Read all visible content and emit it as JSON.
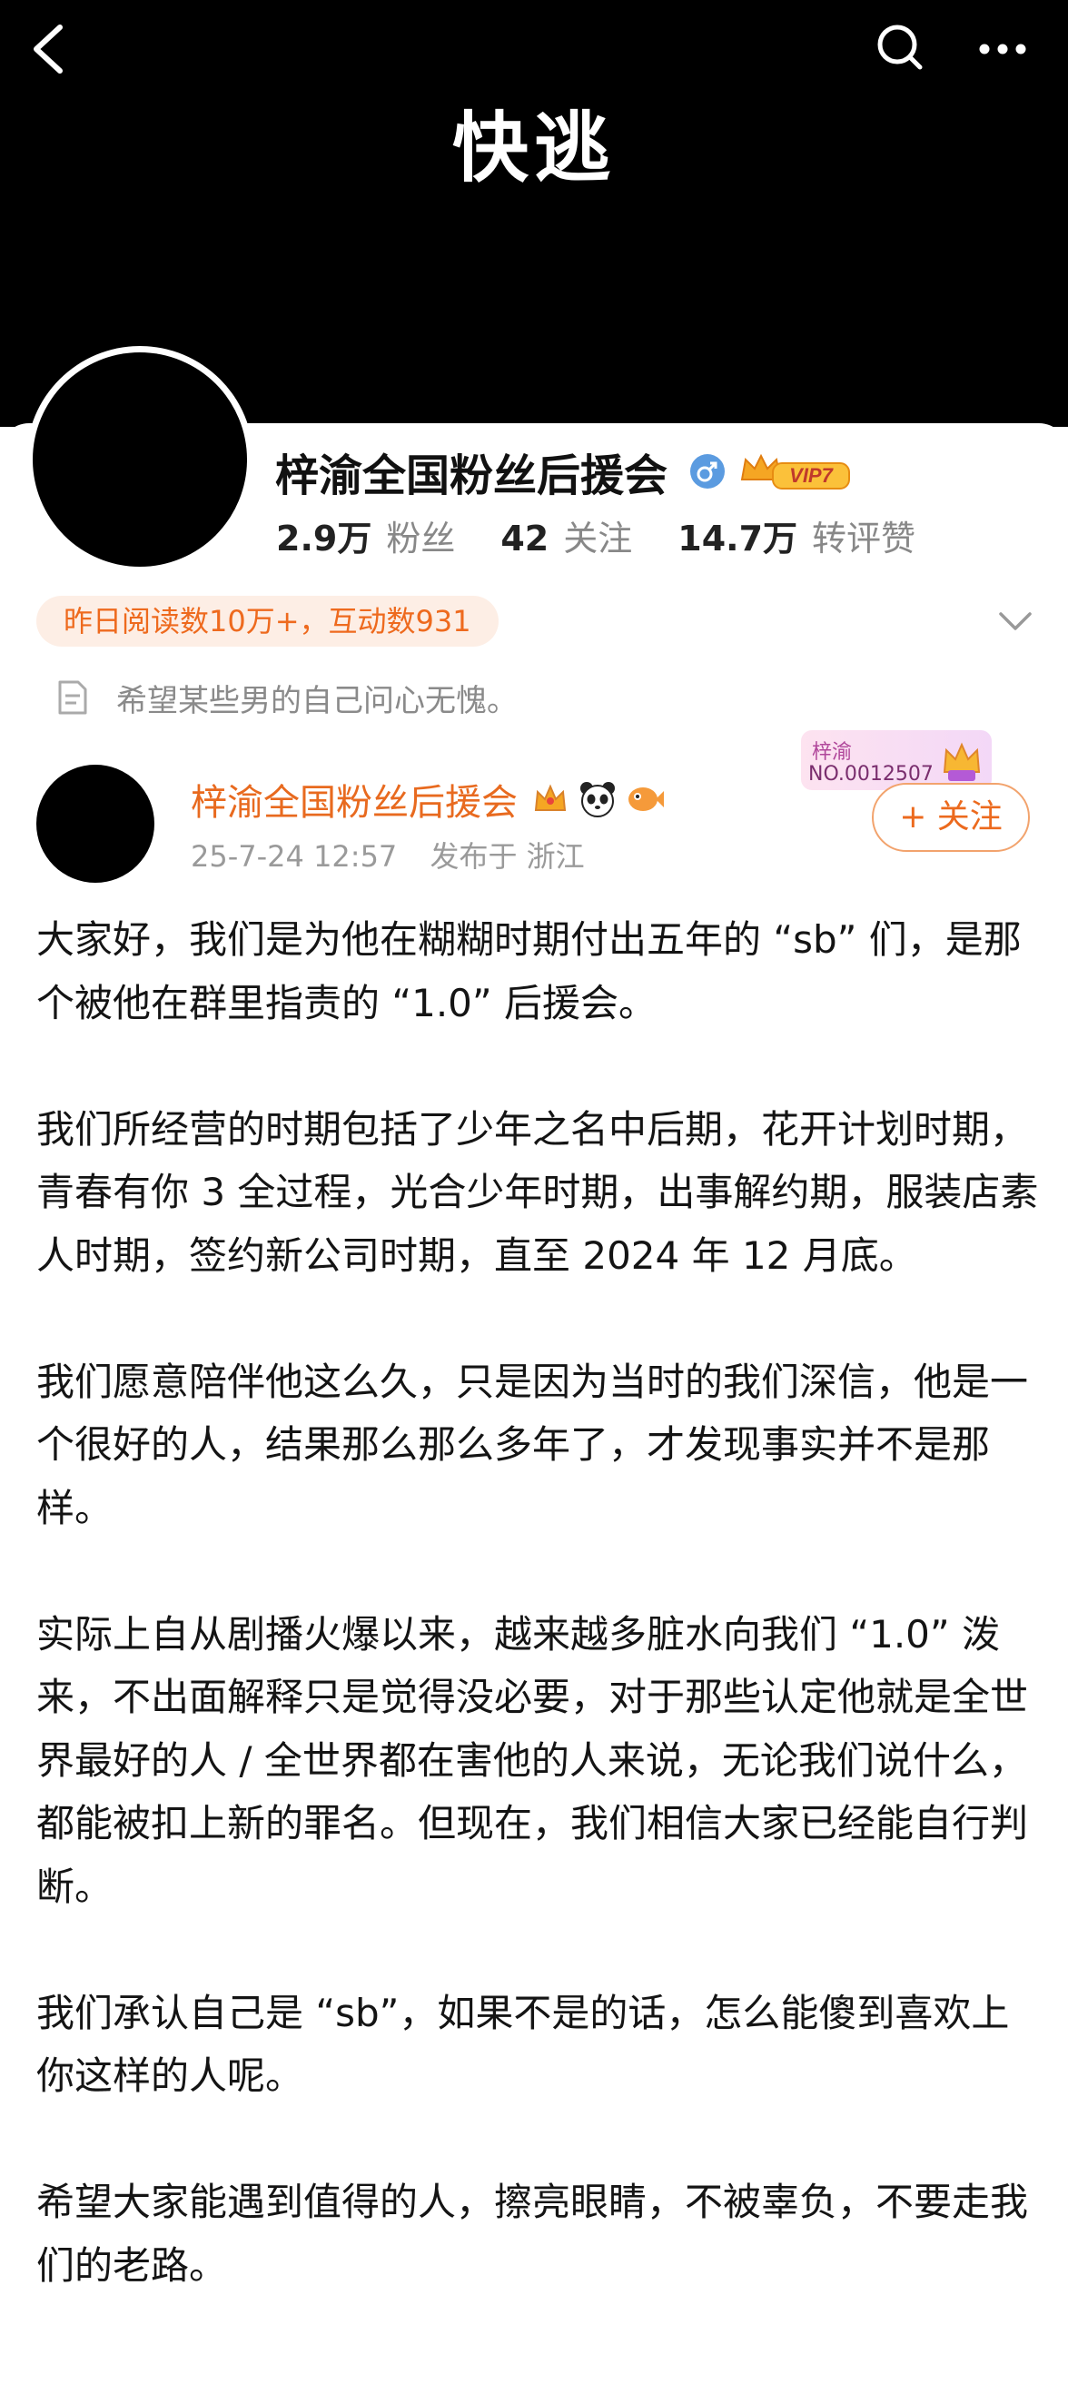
{
  "cover": {
    "title": "快逃"
  },
  "profile": {
    "name": "梓渝全国粉丝后援会",
    "vip_badge": "VIP7",
    "stats": [
      {
        "value": "2.9万",
        "label": "粉丝"
      },
      {
        "value": "42",
        "label": "关注"
      },
      {
        "value": "14.7万",
        "label": "转评赞"
      }
    ],
    "activity_pill": "昨日阅读数10万+，互动数931",
    "bio": "希望某些男的自己问心无愧。"
  },
  "post": {
    "author": "梓渝全国粉丝后援会",
    "time": "25-7-24 12:57",
    "location": "发布于 浙江",
    "fan_badge": {
      "name": "梓渝",
      "number": "NO.0012507"
    },
    "follow_label": "+ 关注",
    "paragraphs": [
      "大家好，我们是为他在糊糊时期付出五年的 “sb” 们，是那个被他在群里指责的 “1.0” 后援会。",
      "我们所经营的时期包括了少年之名中后期，花开计划时期，青春有你 3 全过程，光合少年时期，出事解约期，服装店素人时期，签约新公司时期，直至 2024 年 12 月底。",
      "我们愿意陪伴他这么久，只是因为当时的我们深信，他是一个很好的人，结果那么那么多年了，才发现事实并不是那样。",
      "实际上自从剧播火爆以来，越来越多脏水向我们 “1.0” 泼来，不出面解释只是觉得没必要，对于那些认定他就是全世界最好的人 / 全世界都在害他的人来说，无论我们说什么，都能被扣上新的罪名。但现在，我们相信大家已经能自行判断。",
      "我们承认自己是 “sb”，如果不是的话，怎么能傻到喜欢上你这样的人呢。",
      "希望大家能遇到值得的人，擦亮眼睛，不被辜负，不要走我们的老路。"
    ]
  },
  "colors": {
    "accent": "#ee6a1e",
    "verify": "#5b9be0",
    "vip": "#f5a623"
  }
}
